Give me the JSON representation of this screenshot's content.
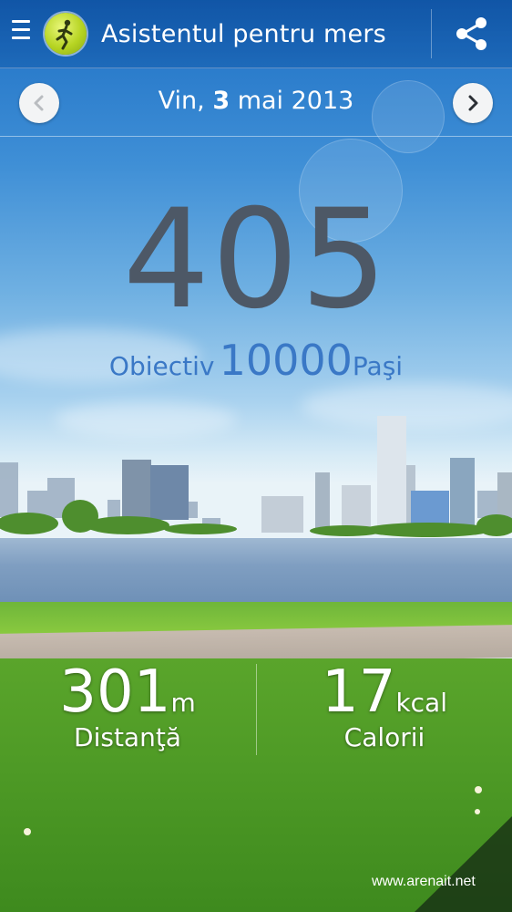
{
  "app_bar": {
    "title": "Asistentul pentru mers",
    "icons": [
      "menu-icon",
      "walker-logo-icon",
      "share-icon"
    ]
  },
  "date_bar": {
    "weekday": "Vin,",
    "day": "3",
    "month_year": "mai 2013",
    "icons": [
      "chevron-left-icon",
      "chevron-right-icon"
    ]
  },
  "counter": {
    "steps": "405",
    "goal_label": "Obiectiv",
    "goal_value": "10000",
    "goal_unit": "Paşi"
  },
  "stats": {
    "distance": {
      "value": "301",
      "unit": "m",
      "label": "Distanţă"
    },
    "calories": {
      "value": "17",
      "unit": "kcal",
      "label": "Calorii"
    }
  },
  "watermark": "www.arenait.net",
  "colors": {
    "header": "#1a60b0",
    "counter_text": "#4d5866",
    "goal_text": "#3a78c6",
    "grass": "#4f9b26"
  }
}
